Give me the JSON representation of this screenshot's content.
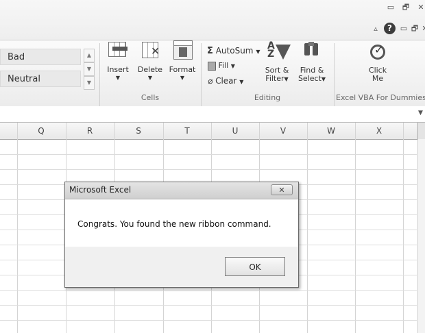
{
  "window": {
    "minimize_glyph": "▭",
    "restore_glyph": "🗗",
    "close_glyph": "✕",
    "wb_up_glyph": "▵",
    "wb_help_glyph": "?",
    "wb_minimize_glyph": "▭",
    "wb_restore_glyph": "🗗",
    "wb_close_glyph": "✕"
  },
  "ribbon": {
    "styles": {
      "bad": "Bad",
      "neutral": "Neutral"
    },
    "cells": {
      "insert": "Insert",
      "delete": "Delete",
      "format": "Format",
      "group": "Cells"
    },
    "editing": {
      "autosum": "AutoSum",
      "fill": "Fill",
      "clear": "Clear",
      "sort_filter_1": "Sort &",
      "sort_filter_2": "Filter",
      "find_select_1": "Find &",
      "find_select_2": "Select",
      "group": "Editing"
    },
    "custom": {
      "click_me_1": "Click",
      "click_me_2": "Me",
      "group": "Excel VBA For Dummies"
    }
  },
  "sheet": {
    "columns": [
      "Q",
      "R",
      "S",
      "T",
      "U",
      "V",
      "W",
      "X"
    ]
  },
  "dialog": {
    "title": "Microsoft Excel",
    "message": "Congrats. You found the new ribbon command.",
    "ok": "OK",
    "close_glyph": "✕"
  },
  "colors": {
    "ribbon_bg": "#f3f3f3",
    "grid_line": "#d4d4d4",
    "dialog_footer": "#f0f0f0",
    "help_icon": "#3c3c3c"
  }
}
